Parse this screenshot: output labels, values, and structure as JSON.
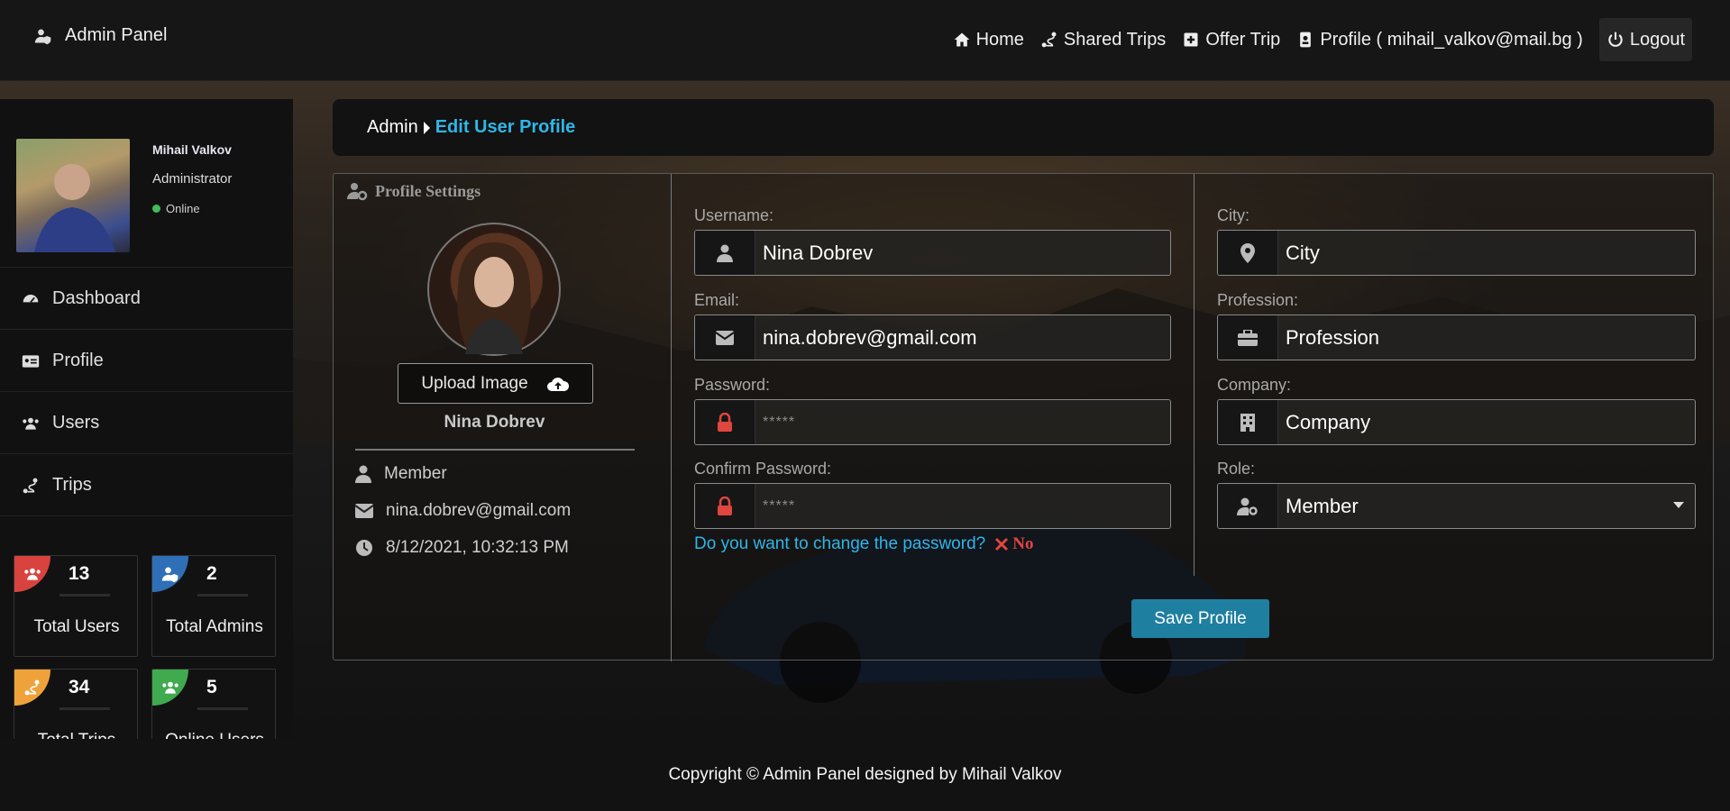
{
  "brand": {
    "title": "Admin Panel",
    "icon": "user-shield-icon"
  },
  "nav": {
    "home": "Home",
    "shared_trips": "Shared Trips",
    "offer_trip": "Offer Trip",
    "profile": "Profile ( mihail_valkov@mail.bg )",
    "logout": "Logout"
  },
  "sidebar": {
    "user": {
      "name": "Mihail Valkov",
      "role": "Administrator",
      "status": "Online"
    },
    "items": [
      {
        "label": "Dashboard",
        "icon": "tachometer-icon"
      },
      {
        "label": "Profile",
        "icon": "id-card-icon"
      },
      {
        "label": "Users",
        "icon": "users-icon"
      },
      {
        "label": "Trips",
        "icon": "route-icon"
      }
    ],
    "stats": [
      {
        "value": "13",
        "label": "Total Users",
        "color": "#d9433f"
      },
      {
        "value": "2",
        "label": "Total Admins",
        "color": "#2f6fb8"
      },
      {
        "value": "34",
        "label": "Total Trips",
        "color": "#f0a23a"
      },
      {
        "value": "5",
        "label": "Online Users",
        "color": "#3faa4e"
      }
    ]
  },
  "breadcrumb": {
    "root": "Admin",
    "current": "Edit User Profile"
  },
  "profile_settings": {
    "title": "Profile Settings",
    "upload_label": "Upload Image",
    "name": "Nina Dobrev",
    "role": "Member",
    "email": "nina.dobrev@gmail.com",
    "created": "8/12/2021, 10:32:13 PM"
  },
  "form": {
    "username": {
      "label": "Username:",
      "value": "Nina Dobrev"
    },
    "email": {
      "label": "Email:",
      "value": "nina.dobrev@gmail.com"
    },
    "password": {
      "label": "Password:",
      "placeholder": "*****"
    },
    "confirm_password": {
      "label": "Confirm Password:",
      "placeholder": "*****"
    },
    "change_password_question": "Do you want to change the password?",
    "change_password_answer": "No",
    "city": {
      "label": "City:",
      "value": "City"
    },
    "profession": {
      "label": "Profession:",
      "value": "Profession"
    },
    "company": {
      "label": "Company:",
      "value": "Company"
    },
    "role": {
      "label": "Role:",
      "value": "Member"
    },
    "save_label": "Save Profile"
  },
  "footer": "Copyright © Admin Panel designed by Mihail Valkov",
  "colors": {
    "accent": "#2fb6e8",
    "save": "#1f7fa0",
    "lock": "#e0453f"
  }
}
